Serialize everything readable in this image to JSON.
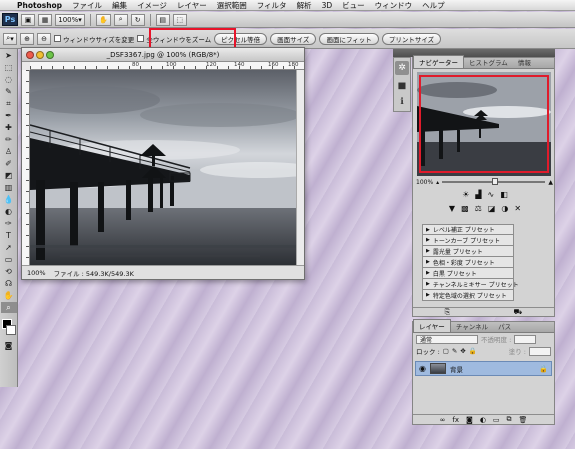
{
  "menubar": {
    "apple": "",
    "items": [
      "Photoshop",
      "ファイル",
      "編集",
      "イメージ",
      "レイヤー",
      "選択範囲",
      "フィルタ",
      "解析",
      "3D",
      "ビュー",
      "ウィンドウ",
      "ヘルプ"
    ]
  },
  "appbar": {
    "logo": "Ps",
    "zoom": "100%"
  },
  "options": {
    "check_resize": "ウィンドウサイズを変更",
    "check_all": "全ウィンドウをズーム",
    "btn_actual": "ピクセル等倍",
    "btn_screen": "画面サイズ",
    "btn_fit": "画面にフィット",
    "btn_print": "プリントサイズ"
  },
  "document": {
    "title": "_DSF3367.jpg @ 100% (RGB/8*)",
    "ruler_marks": [
      "80",
      "100",
      "120",
      "140",
      "160",
      "180"
    ],
    "zoom": "100%",
    "file_info": "ファイル : 549.3K/549.3K"
  },
  "navigator": {
    "tabs": [
      "ナビゲーター",
      "ヒストグラム",
      "情報"
    ],
    "zoom": "100%"
  },
  "adjustments": {
    "presets": [
      "レベル補正 プリセット",
      "トーンカーブ プリセット",
      "露光量 プリセット",
      "色相・彩度 プリセット",
      "白黒 プリセット",
      "チャンネルミキサー プリセット",
      "特定色域の選択 プリセット"
    ]
  },
  "layers": {
    "tabs": [
      "レイヤー",
      "チャンネル",
      "パス"
    ],
    "blend_mode": "通常",
    "opacity_label": "不透明度 :",
    "lock_label": "ロック :",
    "fill_label": "塗り :",
    "layer_name": "背景"
  },
  "colors": {
    "accent_red": "#e8132a",
    "layer_selected": "#9fbadf"
  }
}
